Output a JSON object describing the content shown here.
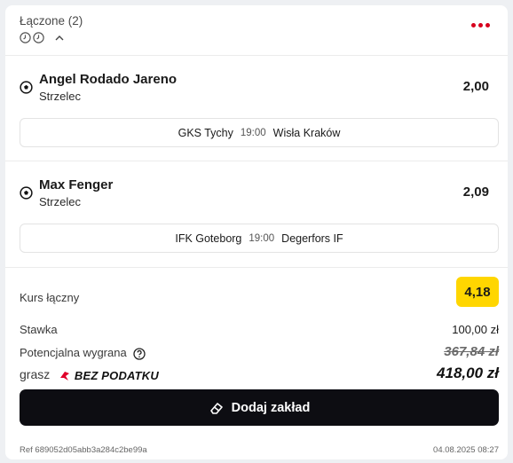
{
  "header": {
    "title": "Łączone (2)",
    "icons": [
      "clock-icon",
      "clock-icon",
      "chevron-up-icon"
    ],
    "menu_icon": "more-dots-icon",
    "accent": "#d7001d"
  },
  "selections": [
    {
      "player": "Angel Rodado Jareno",
      "market": "Strzelec",
      "odd": "2,00",
      "home": "GKS Tychy",
      "time": "19:00",
      "away": "Wisła Kraków",
      "icon": "soccer-ball-icon"
    },
    {
      "player": "Max Fenger",
      "market": "Strzelec",
      "odd": "2,09",
      "home": "IFK Goteborg",
      "time": "19:00",
      "away": "Degerfors IF",
      "icon": "soccer-ball-icon"
    }
  ],
  "summary": {
    "kurs_label": "Kurs łączny",
    "kurs_value": "4,18",
    "stake_label": "Stawka",
    "stake_value": "100,00 zł",
    "win_label": "Potencjalna wygrana",
    "win_value": "367,84 zł",
    "gramy_label": "grasz",
    "badge_text": "BEZ PODATKU",
    "final_value": "418,00 zł",
    "highlight": "#ffd600"
  },
  "button": {
    "label": "Dodaj zakład",
    "icon": "eraser-icon"
  },
  "footer": {
    "ref": "Ref 689052d05abb3a284c2be99a",
    "date": "04.08.2025 08:27"
  }
}
